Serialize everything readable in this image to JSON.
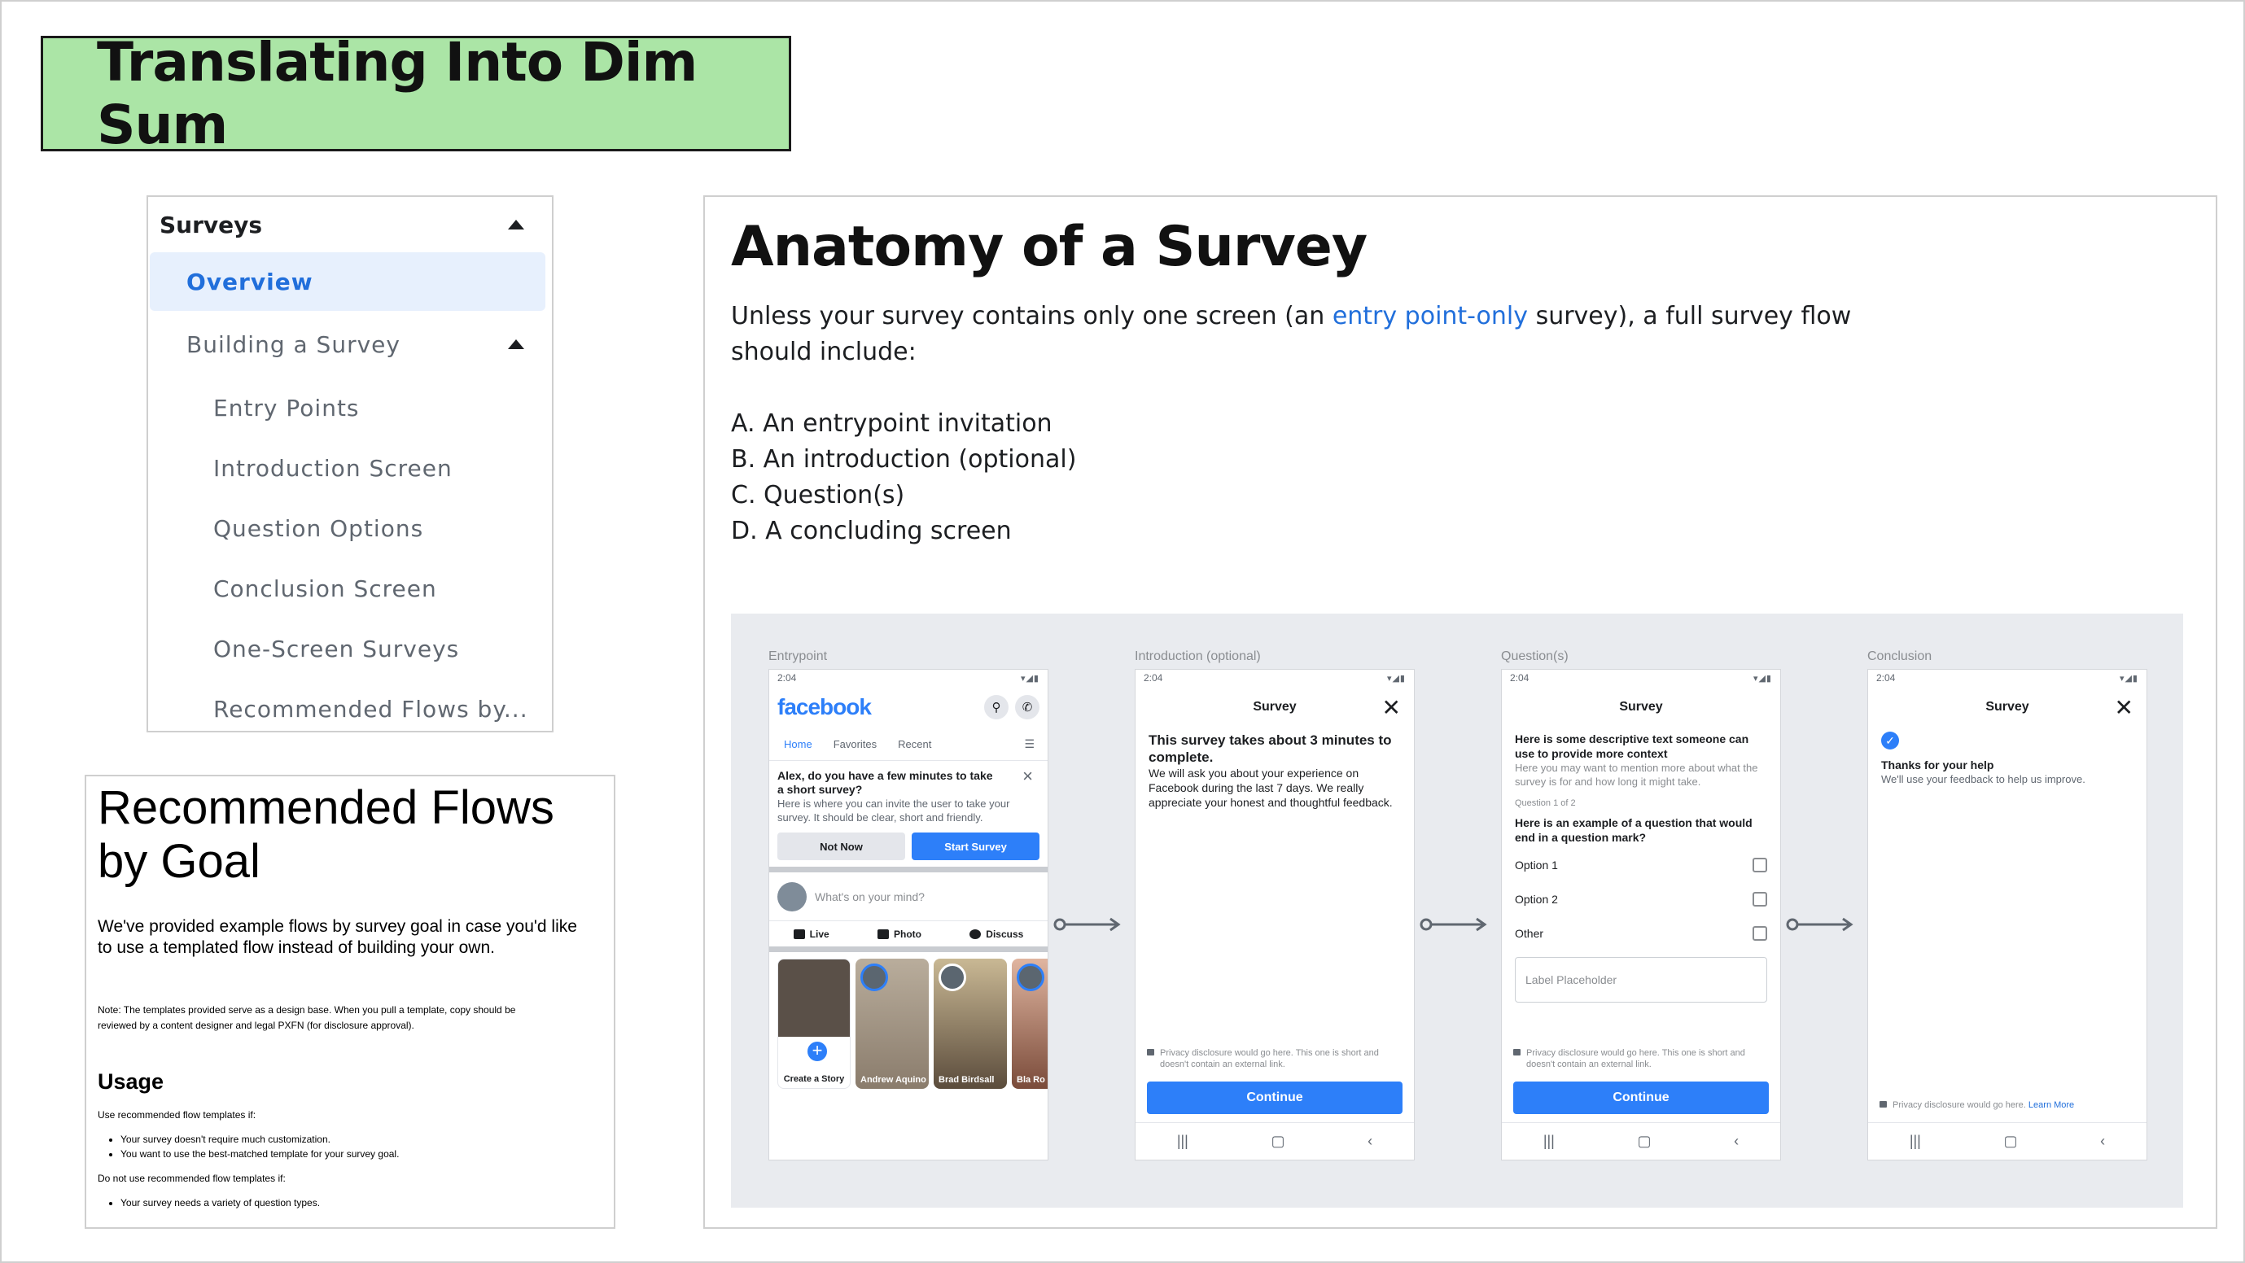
{
  "title": "Translating Into Dim Sum",
  "nav": {
    "header": "Surveys",
    "active": "Overview",
    "section": "Building a Survey",
    "children": [
      "Entry Points",
      "Introduction Screen",
      "Question Options",
      "Conclusion Screen",
      "One-Screen Surveys",
      "Recommended Flows by..."
    ]
  },
  "recommended": {
    "title": "Recommended Flows by Goal",
    "desc": "We've provided example flows by survey goal in case you'd like to use a templated flow instead of building your own.",
    "note": "Note: The templates provided serve as a design base. When you pull a template, copy should be reviewed by a content designer and legal PXFN (for disclosure approval).",
    "usage_heading": "Usage",
    "use_if": "Use recommended flow templates if:",
    "use_items": [
      "Your survey doesn't require much customization.",
      "You want to use the best-matched template for your survey goal."
    ],
    "dont_if": "Do not use recommended flow templates if:",
    "dont_items": [
      "Your survey needs a variety of question types."
    ]
  },
  "main": {
    "heading": "Anatomy of a Survey",
    "para_before": "Unless your survey contains only one screen (an ",
    "para_link": "entry point-only",
    "para_after": " survey), a full survey flow should include:",
    "list": [
      "A. An entrypoint invitation",
      "B. An introduction (optional)",
      "C. Question(s)",
      "D. A concluding screen"
    ]
  },
  "flow": {
    "stages": [
      "Entrypoint",
      "Introduction (optional)",
      "Question(s)",
      "Conclusion"
    ],
    "time": "2:04",
    "survey_title": "Survey",
    "entry": {
      "logo": "facebook",
      "tabs": [
        "Home",
        "Favorites",
        "Recent"
      ],
      "invite_q": "Alex, do you have a few minutes to take a short survey?",
      "invite_d": "Here is where you can invite the user to take your survey. It should be clear, short and friendly.",
      "btn_not": "Not Now",
      "btn_start": "Start Survey",
      "mind": "What's on your mind?",
      "actions": [
        "Live",
        "Photo",
        "Discuss"
      ],
      "stories": [
        "Create a Story",
        "Andrew Aquino",
        "Brad Birdsall",
        "Bla Ro"
      ]
    },
    "intro": {
      "lead": "This survey takes about 3 minutes to complete.",
      "body": "We will ask you about your experience on Facebook during the last 7 days. We really appreciate your honest and thoughtful feedback.",
      "disclosure": "Privacy disclosure would go here. This one is short and doesn't contain an external link.",
      "button": "Continue"
    },
    "question": {
      "lead": "Here is some descriptive text someone can use to provide more context",
      "sub": "Here you may want to mention more about what the survey is for and how long it might take.",
      "counter": "Question 1 of 2",
      "q": "Here is an example of a question that would end in a question mark?",
      "options": [
        "Option 1",
        "Option 2",
        "Other"
      ],
      "placeholder": "Label Placeholder",
      "disclosure": "Privacy disclosure would go here. This one is short and doesn't contain an external link.",
      "button": "Continue"
    },
    "conclusion": {
      "thanks": "Thanks for your help",
      "sub": "We'll use your feedback to help us improve.",
      "disclosure": "Privacy disclosure would go here.",
      "learn": "Learn More"
    }
  }
}
